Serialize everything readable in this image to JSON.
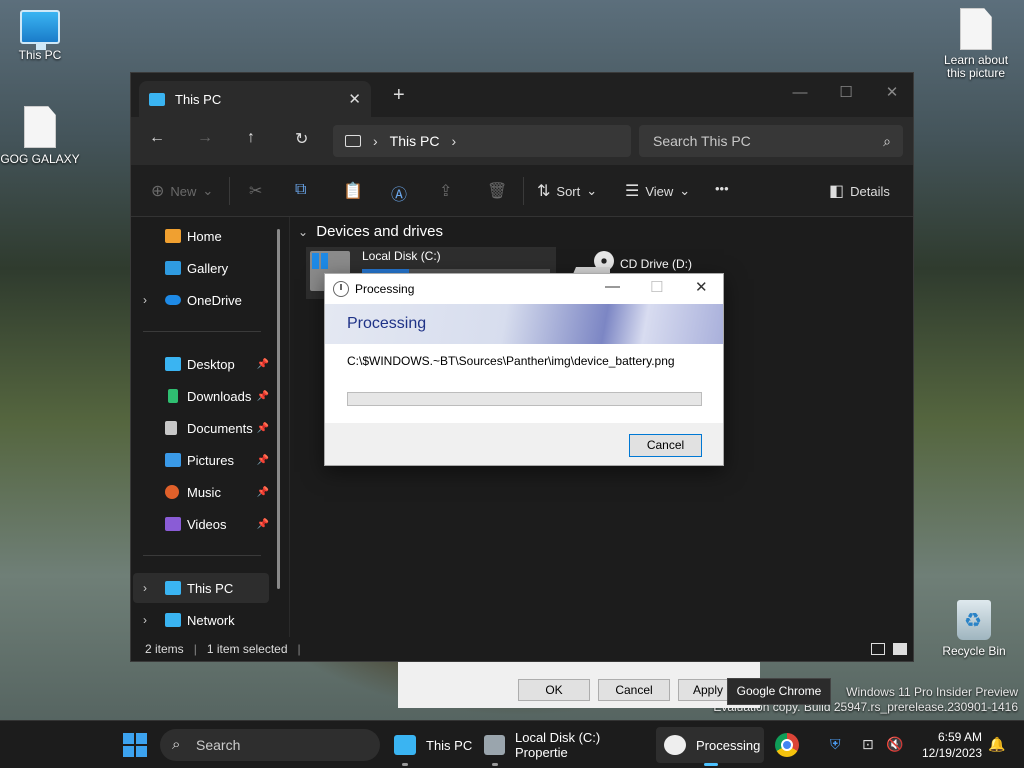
{
  "desktop": {
    "icons": [
      {
        "label": "This PC"
      },
      {
        "label": "GOG GALAXY"
      },
      {
        "label": "Learn about this picture"
      },
      {
        "label": "Recycle Bin"
      }
    ]
  },
  "explorer": {
    "tab_title": "This PC",
    "tab_close": "✕",
    "new_tab": "+",
    "controls": {
      "minimize": "—",
      "maximize": "☐",
      "close": "✕"
    },
    "nav": {
      "back": "←",
      "forward": "→",
      "up": "↑",
      "refresh": "↻"
    },
    "address": {
      "crumb": "This PC",
      "sep1": "›",
      "sep2": "›"
    },
    "search_placeholder": "Search This PC",
    "search_icon": "⌕",
    "commands": {
      "new": "New",
      "sort": "Sort",
      "view": "View",
      "more": "•••",
      "details": "Details",
      "icons": {
        "new": "⊕",
        "cut": "✂",
        "copy": "⧉",
        "paste": "📋",
        "rename": "Ⓐ",
        "share": "⇪",
        "delete": "🗑",
        "sort": "⇅",
        "view": "☰",
        "details": "◧",
        "chevron": "⌄"
      }
    },
    "sidebar": {
      "items": [
        {
          "label": "Home",
          "color": "#f0a030"
        },
        {
          "label": "Gallery",
          "color": "#2f9be0"
        },
        {
          "label": "OneDrive",
          "color": "#1e8ae6"
        },
        {
          "label": "Desktop",
          "color": "#3ab4f2"
        },
        {
          "label": "Downloads",
          "color": "#2fbf71"
        },
        {
          "label": "Documents",
          "color": "#c8c8c8"
        },
        {
          "label": "Pictures",
          "color": "#3a9ae8"
        },
        {
          "label": "Music",
          "color": "#e0602a"
        },
        {
          "label": "Videos",
          "color": "#8a5cd6"
        },
        {
          "label": "This PC",
          "color": "#3ab4f2"
        },
        {
          "label": "Network",
          "color": "#3ab4f2"
        }
      ],
      "pin": "📌",
      "chevron": "›"
    },
    "group_header": "Devices and drives",
    "group_chevron": "⌄",
    "drives": [
      {
        "name": "Local Disk (C:)",
        "used_fraction": 0.25
      },
      {
        "name": "CD Drive (D:)"
      }
    ],
    "status": {
      "items": "2 items",
      "selected": "1 item selected",
      "sep": "|"
    }
  },
  "properties_dialog": {
    "ok": "OK",
    "cancel": "Cancel",
    "apply": "Apply"
  },
  "processing_dialog": {
    "title": "Processing",
    "heading": "Processing",
    "path": "C:\\$WINDOWS.~BT\\Sources\\Panther\\img\\device_battery.png",
    "progress": 0,
    "cancel": "Cancel",
    "controls": {
      "minimize": "—",
      "maximize": "☐",
      "close": "✕"
    }
  },
  "taskbar": {
    "search": "Search",
    "search_icon": "⌕",
    "apps": [
      {
        "label": "This PC"
      },
      {
        "label": "Local Disk (C:) Propertie"
      },
      {
        "label": "Processing"
      }
    ],
    "tooltip": "Google Chrome",
    "tray_icons": {
      "defender": "⛨",
      "network": "⊡",
      "volume": "🔇",
      "bell": "🔔"
    },
    "time": "6:59 AM",
    "date": "12/19/2023"
  },
  "watermark": {
    "line1": "Windows 11 Pro Insider Preview",
    "line2": "Evaluation copy. Build 25947.rs_prerelease.230901-1416"
  }
}
